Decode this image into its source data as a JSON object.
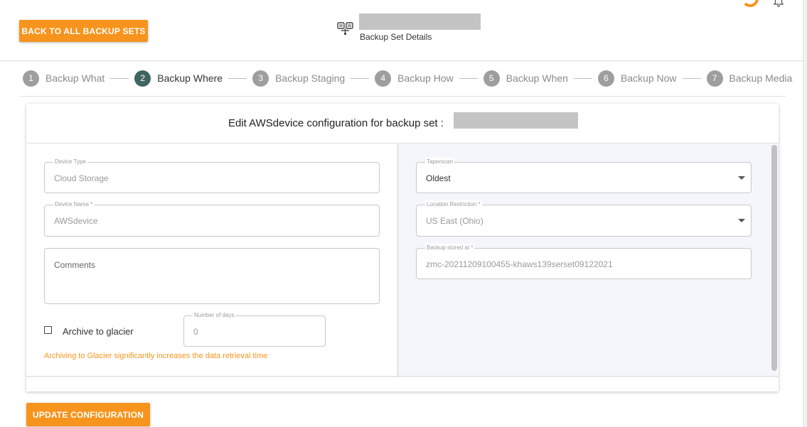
{
  "header": {
    "back_label": "BACK TO ALL BACKUP SETS",
    "subtitle": "Backup Set Details",
    "icon": "backup-set-icon"
  },
  "stepper": {
    "steps": [
      {
        "number": "1",
        "label": "Backup What",
        "active": false
      },
      {
        "number": "2",
        "label": "Backup Where",
        "active": true
      },
      {
        "number": "3",
        "label": "Backup Staging",
        "active": false
      },
      {
        "number": "4",
        "label": "Backup How",
        "active": false
      },
      {
        "number": "5",
        "label": "Backup When",
        "active": false
      },
      {
        "number": "6",
        "label": "Backup Now",
        "active": false
      },
      {
        "number": "7",
        "label": "Backup Media",
        "active": false
      }
    ]
  },
  "card": {
    "title": "Edit AWSdevice configuration for backup set :"
  },
  "left": {
    "device_type": {
      "label": "Device Type",
      "value": "Cloud Storage"
    },
    "device_name": {
      "label": "Device Name *",
      "value": "AWSdevice"
    },
    "comments": {
      "placeholder": "Comments"
    },
    "archive_label": "Archive to glacier",
    "archive_checked": false,
    "number_of_days": {
      "label": "Number of days",
      "value": "0"
    },
    "note": "Archiving to Glacier significantly increases the data retrieval time"
  },
  "right": {
    "taperscan": {
      "label": "Taperscan",
      "value": "Oldest"
    },
    "location_restriction": {
      "label": "Location Restriction *",
      "value": "US East (Ohio)"
    },
    "backup_stored_at": {
      "label": "Backup stored at *",
      "value": "zmc-20211209100455-khaws139serset09122021"
    }
  },
  "footer": {
    "update_label": "UPDATE CONFIGURATION"
  },
  "colors": {
    "accent": "#f7941d",
    "active_step": "#3f6561",
    "inactive_step": "#9e9e9e"
  }
}
